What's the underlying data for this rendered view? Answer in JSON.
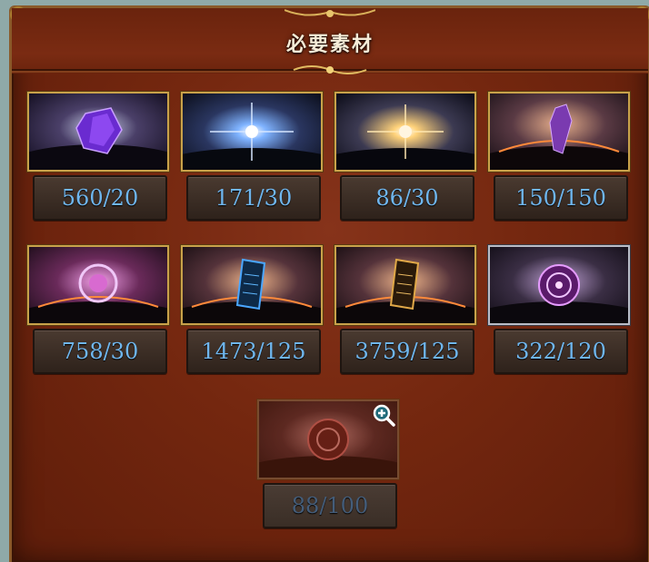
{
  "header": {
    "title": "必要素材"
  },
  "materials": [
    {
      "icon": "purple-crystal-cluster-icon",
      "count": "560/20"
    },
    {
      "icon": "blue-star-orb-icon",
      "count": "171/30"
    },
    {
      "icon": "golden-star-orb-icon",
      "count": "86/30"
    },
    {
      "icon": "violet-crystal-shard-icon",
      "count": "150/150"
    },
    {
      "icon": "pink-spiral-emblem-icon",
      "count": "758/30"
    },
    {
      "icon": "blue-scroll-tablet-icon",
      "count": "1473/125"
    },
    {
      "icon": "gold-scroll-tablet-icon",
      "count": "3759/125"
    },
    {
      "icon": "purple-sigil-medallion-icon",
      "count": "322/120"
    },
    {
      "icon": "red-sigil-medallion-icon",
      "count": "88/100"
    }
  ],
  "colors": {
    "count_text": "#6fb6ee",
    "count_text_disabled": "#445d7a",
    "panel_bg": "#74270f",
    "frame_gold": "#c9a24a"
  }
}
